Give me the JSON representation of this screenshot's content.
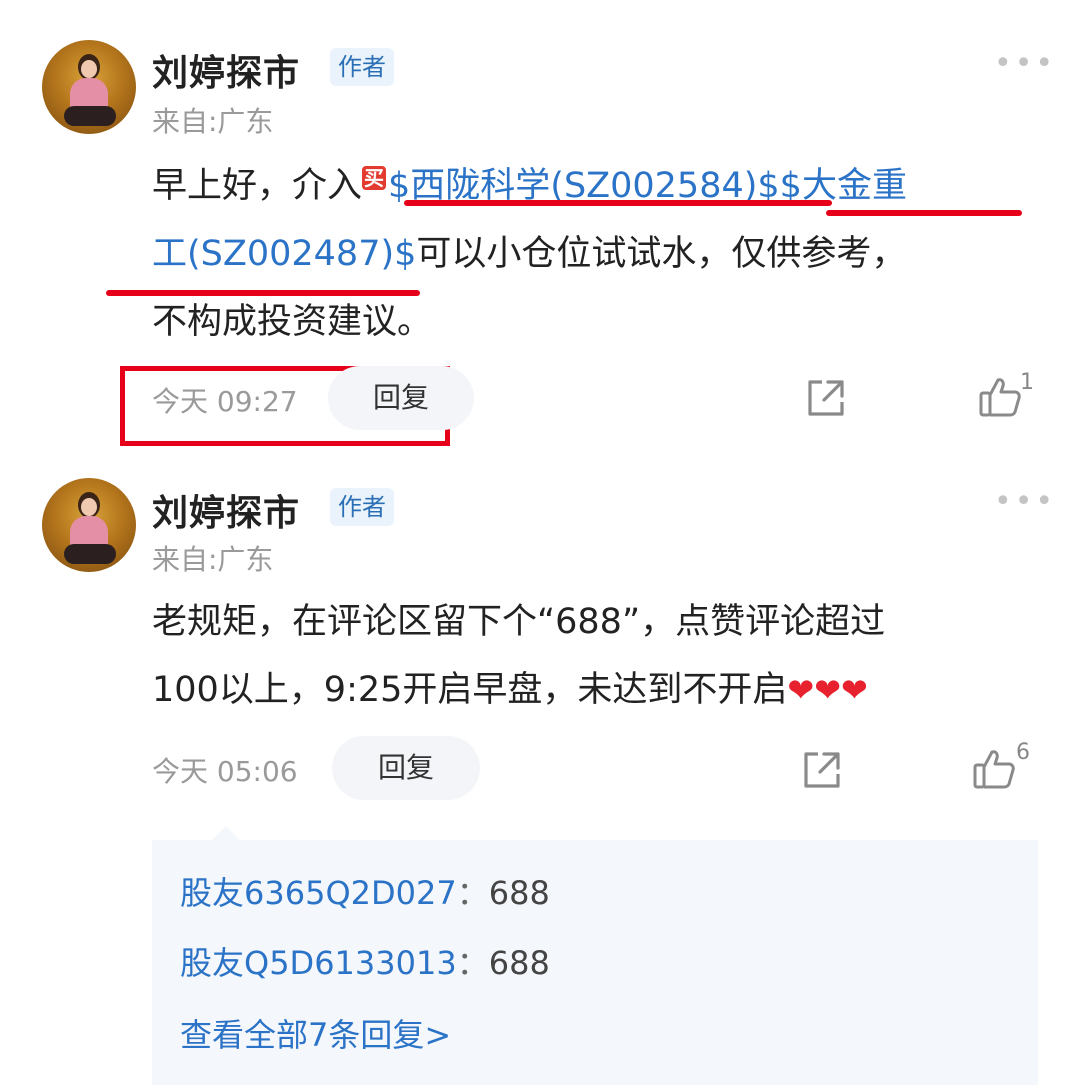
{
  "comments": [
    {
      "author": "刘婷探市",
      "badge": "作者",
      "location": "来自:广东",
      "text_parts": {
        "p1": "早上好，介入",
        "buy_tag": "买",
        "stock1": "$西陇科学(SZ002584)$",
        "stock2a": "$大金重",
        "stock2b": "工(SZ002487)$",
        "p2": "可以小仓位试试水，仅供参考，",
        "p3": "不构成投资建议。"
      },
      "time": "今天 09:27",
      "reply_label": "回复",
      "like_count": "1",
      "share_icon": "share-icon",
      "like_icon": "thumbs-up-icon",
      "more_icon": "more-dots-icon"
    },
    {
      "author": "刘婷探市",
      "badge": "作者",
      "location": "来自:广东",
      "text_line1": "老规矩，在评论区留下个“688”，点赞评论超过",
      "text_line2": "100以上，9:25开启早盘，未达到不开启",
      "hearts": "❤❤❤",
      "time": "今天 05:06",
      "reply_label": "回复",
      "like_count": "6",
      "replies": [
        {
          "user": "股友6365Q2D027",
          "sep": "：",
          "content": "688"
        },
        {
          "user": "股友Q5D6133013",
          "sep": "：",
          "content": "688"
        }
      ],
      "view_all": "查看全部7条回复>"
    }
  ],
  "colors": {
    "link": "#2b73c7",
    "annotation_red": "#e6001a",
    "heart": "#e8212e",
    "badge_bg": "#eaf3fc"
  }
}
